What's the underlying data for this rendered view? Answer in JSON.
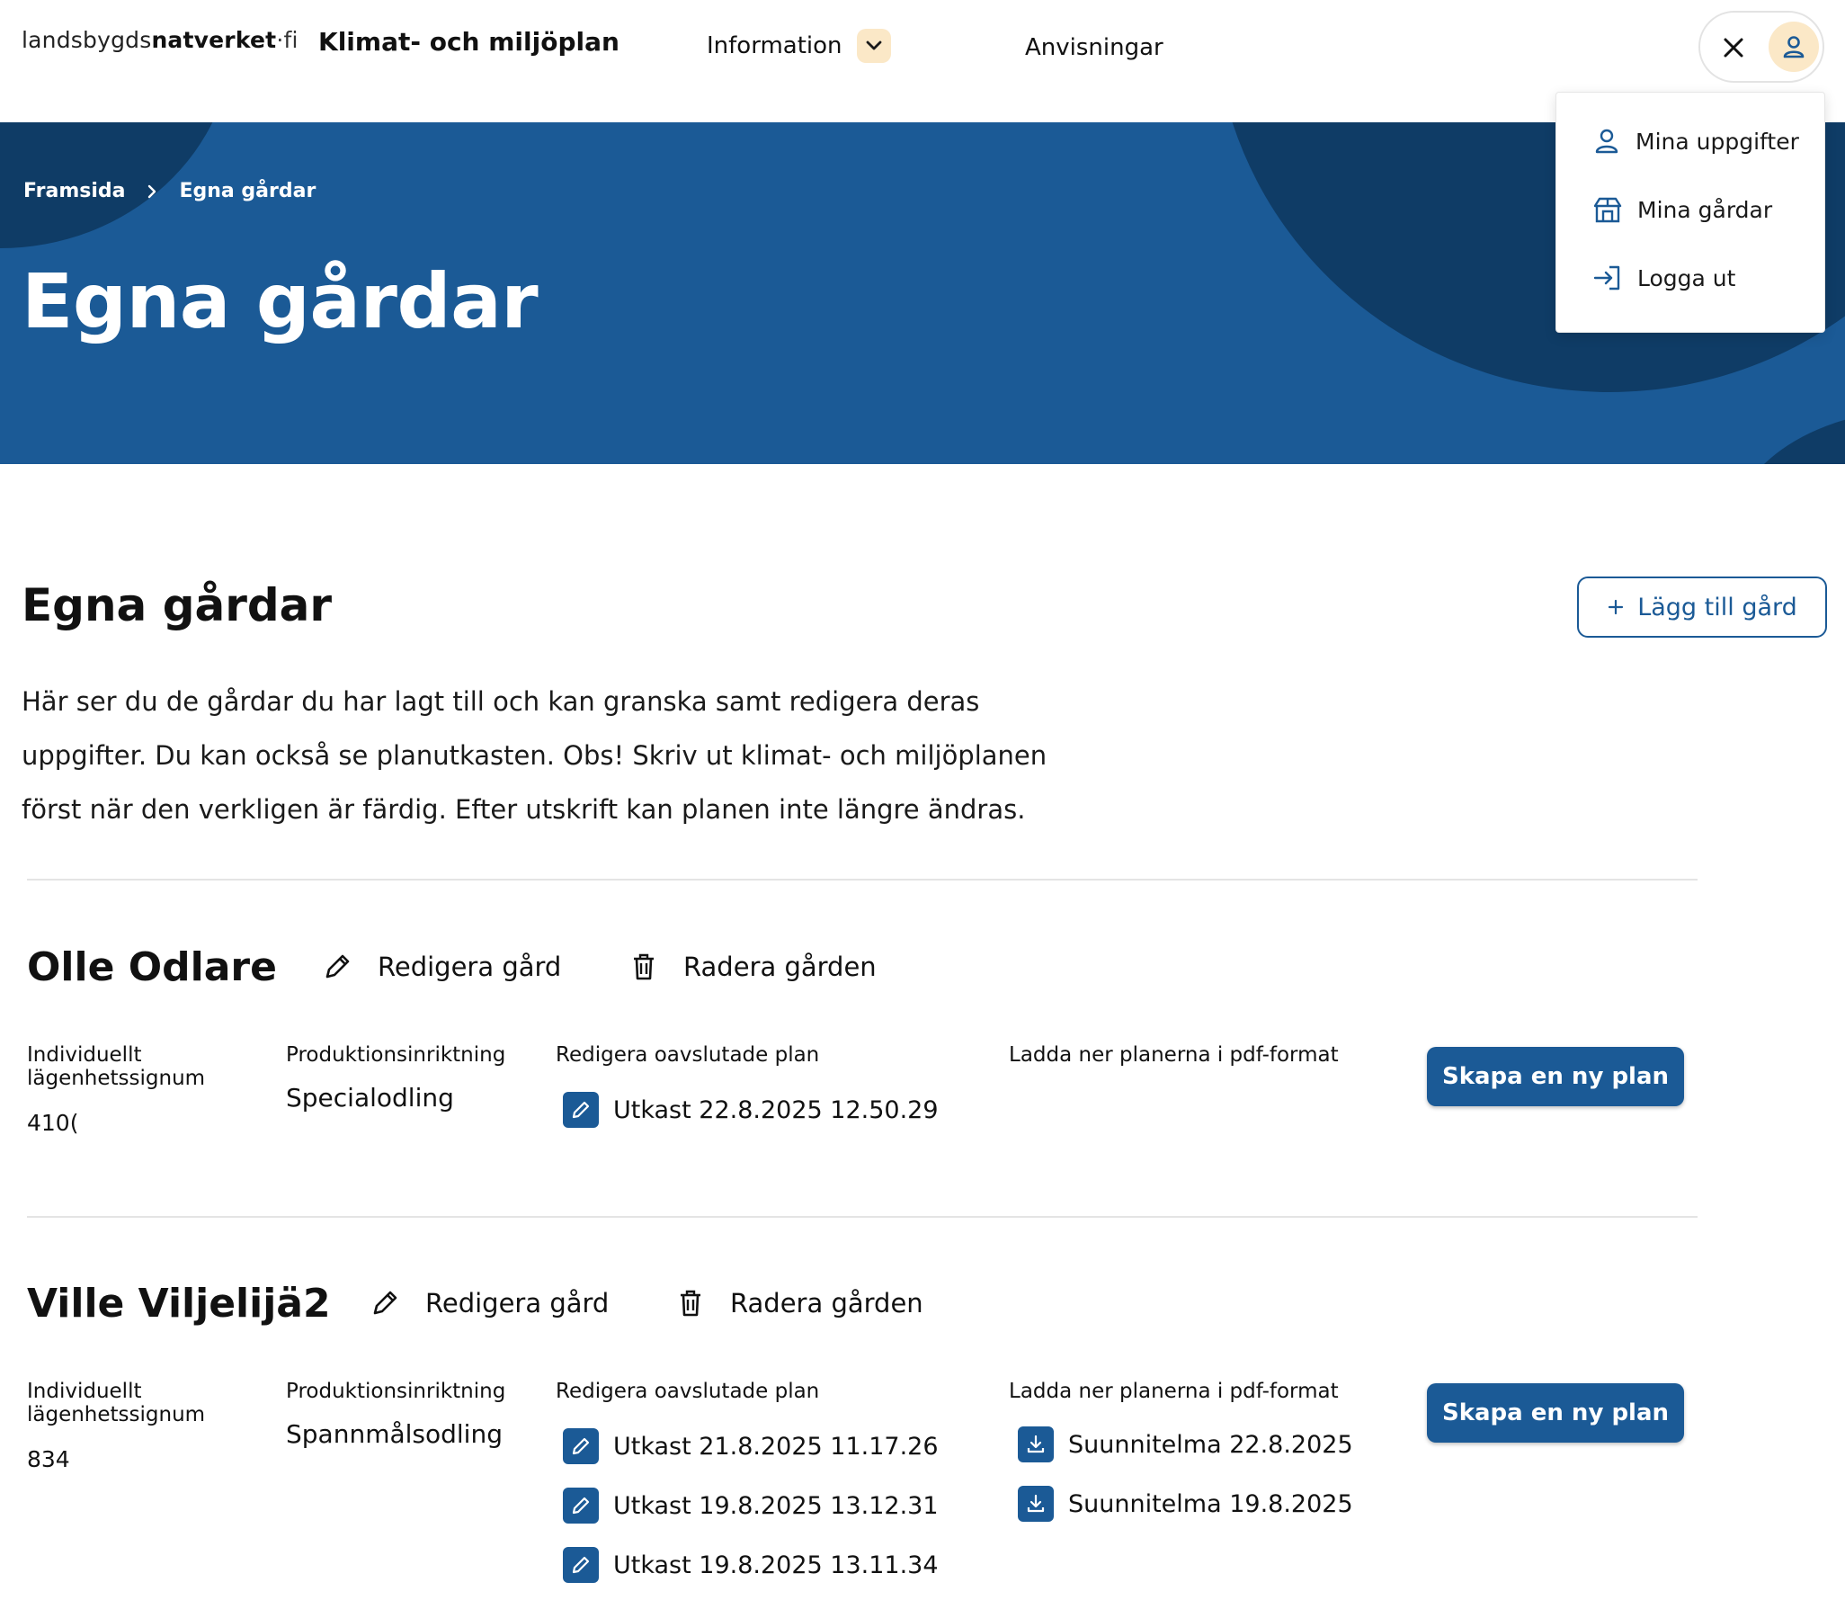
{
  "header": {
    "logo_plain": "landsbygds",
    "logo_bold": "natverket",
    "logo_suffix": "·fi",
    "app_title": "Klimat- och miljöplan",
    "nav_information": "Information",
    "nav_anvisningar": "Anvisningar"
  },
  "icons": {
    "chevron": "chevron-down-icon",
    "close": "close-icon",
    "user": "user-icon",
    "farm": "farm-icon",
    "logout": "logout-icon",
    "edit": "pencil-icon",
    "delete": "trash-icon",
    "plan_edit": "edit-square-icon",
    "download": "download-icon"
  },
  "colors": {
    "brand_blue": "#1b5a96",
    "hero_dark": "#0f3c66",
    "accent_peach": "#fbe8c7"
  },
  "user_menu": {
    "items": [
      {
        "label": "Mina uppgifter"
      },
      {
        "label": "Mina gårdar"
      },
      {
        "label": "Logga ut"
      }
    ]
  },
  "hero": {
    "breadcrumb_home": "Framsida",
    "breadcrumb_current": "Egna gårdar",
    "title": "Egna gårdar"
  },
  "main": {
    "title": "Egna gårdar",
    "add_farm_label": "Lägg till gård",
    "intro_lines": [
      "Här ser du de gårdar du har lagt till och kan granska samt redigera deras",
      "uppgifter. Du kan också se planutkasten. Obs! Skriv ut klimat- och miljöplanen",
      "först när den verkligen är färdig. Efter utskrift kan planen inte längre ändras."
    ]
  },
  "labels": {
    "edit_farm": "Redigera gård",
    "delete_farm": "Radera gården",
    "id_label_line1": "Individuellt",
    "id_label_line2": "lägenhetssignum",
    "production_label": "Produktionsinriktning",
    "edit_plan_label": "Redigera oavslutade plan",
    "download_label": "Ladda ner planerna i pdf-format",
    "new_plan": "Skapa en ny plan"
  },
  "farms": [
    {
      "name": "Olle Odlare",
      "id": "410(",
      "production": "Specialodling",
      "drafts": [
        "Utkast 22.8.2025 12.50.29"
      ],
      "downloads": []
    },
    {
      "name": "Ville Viljelijä2",
      "id": "834",
      "production": "Spannmålsodling",
      "drafts": [
        "Utkast 21.8.2025 11.17.26",
        "Utkast 19.8.2025 13.12.31",
        "Utkast 19.8.2025 13.11.34"
      ],
      "downloads": [
        "Suunnitelma 22.8.2025",
        "Suunnitelma 19.8.2025"
      ]
    }
  ]
}
